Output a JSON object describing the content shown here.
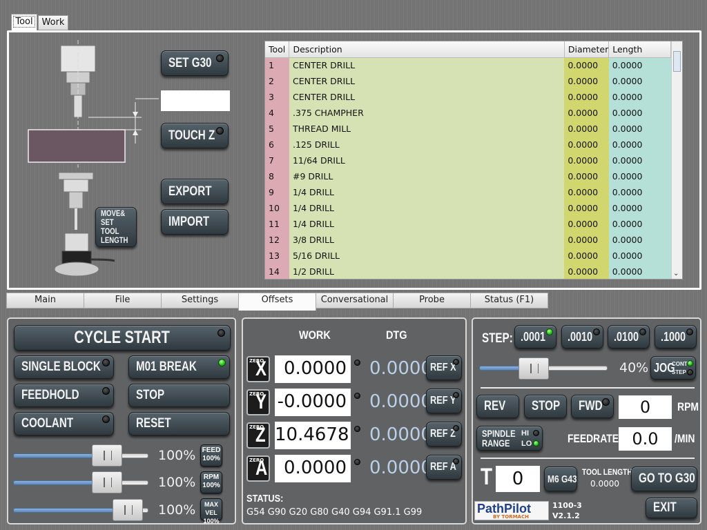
{
  "inner_tabs": [
    "Tool",
    "Work"
  ],
  "tool_area": {
    "set_g30": "SET G30",
    "touch_z": "TOUCH Z",
    "export": "EXPORT",
    "import": "IMPORT",
    "move_set_tool_length": [
      "MOVE&",
      "SET TOOL",
      "LENGTH"
    ]
  },
  "tool_table": {
    "headers": [
      "Tool",
      "Description",
      "Diameter",
      "Length"
    ],
    "rows": [
      [
        "1",
        "CENTER DRILL",
        "0.0000",
        "0.0000"
      ],
      [
        "2",
        "CENTER DRILL",
        "0.0000",
        "0.0000"
      ],
      [
        "3",
        "CENTER DRILL",
        "0.0000",
        "0.0000"
      ],
      [
        "4",
        ".375 CHAMPHER",
        "0.0000",
        "0.0000"
      ],
      [
        "5",
        "THREAD MILL",
        "0.0000",
        "0.0000"
      ],
      [
        "6",
        ".125  DRILL",
        "0.0000",
        "0.0000"
      ],
      [
        "7",
        "11/64 DRILL",
        "0.0000",
        "0.0000"
      ],
      [
        "8",
        "#9 DRILL",
        "0.0000",
        "0.0000"
      ],
      [
        "9",
        "1/4 DRILL",
        "0.0000",
        "0.0000"
      ],
      [
        "10",
        "1/4 DRILL",
        "0.0000",
        "0.0000"
      ],
      [
        "11",
        "1/4 DRILL",
        "0.0000",
        "0.0000"
      ],
      [
        "12",
        "3/8 DRILL",
        "0.0000",
        "0.0000"
      ],
      [
        "13",
        "5/16 DRILL",
        "0.0000",
        "0.0000"
      ],
      [
        "14",
        "1/2 DRILL",
        "0.0000",
        "0.0000"
      ]
    ]
  },
  "main_tabs": [
    "Main",
    "File",
    "Settings",
    "Offsets",
    "Conversational",
    "Probe",
    "Status (F1)"
  ],
  "active_main_tab": "Offsets",
  "left_panel": {
    "cycle_start": "CYCLE START",
    "single_block": "SINGLE BLOCK",
    "m01_break": "M01 BREAK",
    "feedhold": "FEEDHOLD",
    "stop": "STOP",
    "coolant": "COOLANT",
    "reset": "RESET",
    "feed_pct": "100%",
    "rpm_pct": "100%",
    "maxvel_pct": "100%",
    "feed_btn": [
      "FEED",
      "100%"
    ],
    "rpm_btn": [
      "RPM",
      "100%"
    ],
    "maxvel_btn": [
      "MAX VEL",
      "100%"
    ],
    "feed_level": 0.75,
    "rpm_level": 0.75,
    "maxvel_level": 0.95
  },
  "dro": {
    "work_header": "WORK",
    "dtg_header": "DTG",
    "axes": [
      {
        "zero": "ZERO",
        "axis": "X",
        "work": "0.0000",
        "dtg": "0.0000",
        "ref": "REF X"
      },
      {
        "zero": "ZERO",
        "axis": "Y",
        "work": "-0.0000",
        "dtg": "0.0000",
        "ref": "REF Y"
      },
      {
        "zero": "ZERO",
        "axis": "Z",
        "work": "10.4678",
        "dtg": "0.0000",
        "ref": "REF Z"
      },
      {
        "zero": "ZERO",
        "axis": "A",
        "work": "0.0000",
        "dtg": "0.0000",
        "ref": "REF A"
      }
    ],
    "status_label": "STATUS:",
    "status_codes": "G54 G90 G20 G80 G40 G94 G91.1 G99"
  },
  "right_panel": {
    "step_label": "STEP:",
    "steps": [
      ".0001",
      ".0010",
      ".0100",
      ".1000"
    ],
    "active_step": 0,
    "jog_pct": "40%",
    "jog_level": 0.4,
    "jog_btn": "JOG",
    "jog_cont": "CONT",
    "jog_step": "STEP",
    "rev": "REV",
    "stop": "STOP",
    "fwd": "FWD",
    "rpm_value": "0",
    "rpm_label": "RPM",
    "spindle_range": [
      "SPINDLE",
      "RANGE"
    ],
    "hi": "HI",
    "lo": "LO",
    "feedrate_label": "FEEDRATE:",
    "feedrate_value": "0.0",
    "feedrate_unit": "/MIN",
    "t_label": "T",
    "tool_value": "0",
    "m6g43": "M6 G43",
    "tool_length_label": "TOOL LENGTH",
    "tool_length_value": "0.0000",
    "go_to_g30": "GO TO G30",
    "exit": "EXIT",
    "logo_main": "PathPilot",
    "logo_sub": "BY TORMACH",
    "model": "1100-3",
    "version": "V2.1.2"
  }
}
